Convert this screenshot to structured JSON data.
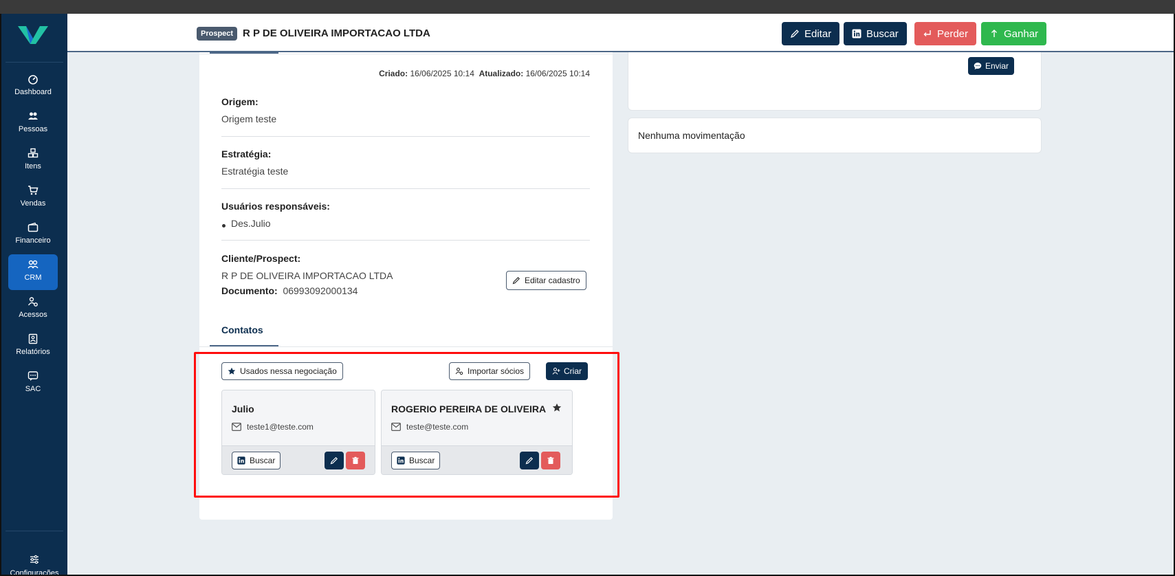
{
  "sidebar": {
    "items": [
      {
        "label": "Dashboard",
        "icon": "dashboard-icon"
      },
      {
        "label": "Pessoas",
        "icon": "people-icon"
      },
      {
        "label": "Itens",
        "icon": "boxes-icon"
      },
      {
        "label": "Vendas",
        "icon": "cart-icon"
      },
      {
        "label": "Financeiro",
        "icon": "wallet-icon"
      },
      {
        "label": "CRM",
        "icon": "crm-icon",
        "active": true
      },
      {
        "label": "Acessos",
        "icon": "user-gear-icon"
      },
      {
        "label": "Relatórios",
        "icon": "report-icon"
      },
      {
        "label": "SAC",
        "icon": "chat-icon"
      }
    ],
    "config_label": "Configurações"
  },
  "header": {
    "badge": "Prospect",
    "title": "R P DE OLIVEIRA IMPORTACAO LTDA",
    "buttons": {
      "editar": "Editar",
      "buscar": "Buscar",
      "perder": "Perder",
      "ganhar": "Ganhar"
    }
  },
  "details": {
    "created_label": "Criado:",
    "created_value": "16/06/2025 10:14",
    "updated_label": "Atualizado:",
    "updated_value": "16/06/2025 10:14",
    "origem_label": "Origem:",
    "origem_value": "Origem teste",
    "estrategia_label": "Estratégia:",
    "estrategia_value": "Estratégia teste",
    "usuarios_label": "Usuários responsáveis:",
    "usuarios": [
      "Des.Julio"
    ],
    "cliente_label": "Cliente/Prospect:",
    "cliente_value": "R P DE OLIVEIRA IMPORTACAO LTDA",
    "documento_label": "Documento:",
    "documento_value": "06993092000134",
    "editar_cadastro": "Editar cadastro"
  },
  "contacts": {
    "tab_label": "Contatos",
    "filter_button": "Usados nessa negociação",
    "import_button": "Importar sócios",
    "create_button": "Criar",
    "cards": [
      {
        "name": "Julio",
        "email": "teste1@teste.com",
        "starred": false,
        "buscar": "Buscar"
      },
      {
        "name": "ROGERIO PEREIRA DE OLIVEIRA",
        "email": "teste@teste.com",
        "starred": true,
        "buscar": "Buscar"
      }
    ]
  },
  "right": {
    "send_button": "Enviar",
    "movements_empty": "Nenhuma movimentação"
  },
  "colors": {
    "sidebar": "#0c2e4f",
    "active": "#1565c0",
    "danger": "#e35b5b",
    "success": "#2fb84e",
    "highlight": "#ff0d0d"
  }
}
